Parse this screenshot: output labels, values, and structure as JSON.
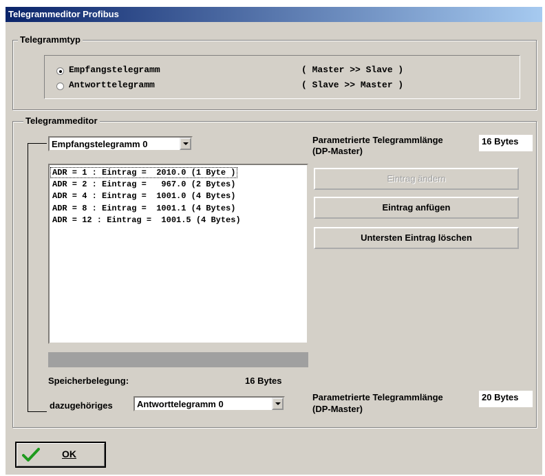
{
  "window": {
    "title": "Telegrammeditor Profibus"
  },
  "telegramm_typ": {
    "legend": "Telegrammtyp",
    "options": [
      {
        "label": "Empfangstelegramm",
        "direction": "( Master >> Slave )",
        "selected": true
      },
      {
        "label": "Antworttelegramm",
        "direction": "( Slave >> Master )",
        "selected": false
      }
    ]
  },
  "editor": {
    "legend": "Telegrammeditor",
    "telegram_select": "Empfangstelegramm 0",
    "param_length_label": "Parametrierte Telegrammlänge",
    "param_length_sub": "(DP-Master)",
    "param_length_value": "16 Bytes",
    "entries": [
      "ADR = 1 : Eintrag =  2010.0 (1 Byte )",
      "ADR = 2 : Eintrag =   967.0 (2 Bytes)",
      "ADR = 4 : Eintrag =  1001.0 (4 Bytes)",
      "ADR = 8 : Eintrag =  1001.1 (4 Bytes)",
      "ADR = 12 : Eintrag =  1001.5 (4 Bytes)"
    ],
    "buttons": {
      "change": "Eintrag ändern",
      "append": "Eintrag anfügen",
      "delete_last": "Untersten Eintrag löschen"
    },
    "memory_label": "Speicherbelegung:",
    "memory_value": "16 Bytes",
    "response_label": "dazugehöriges",
    "response_select": "Antworttelegramm 0",
    "response_length_label": "Parametrierte Telegrammlänge",
    "response_length_sub": "(DP-Master)",
    "response_length_value": "20 Bytes"
  },
  "footer": {
    "ok_label": "OK"
  },
  "colors": {
    "titlebar_start": "#0a246a",
    "titlebar_end": "#a6caf0",
    "dialog_bg": "#d4d0c8",
    "check": "#1e9a1e"
  }
}
